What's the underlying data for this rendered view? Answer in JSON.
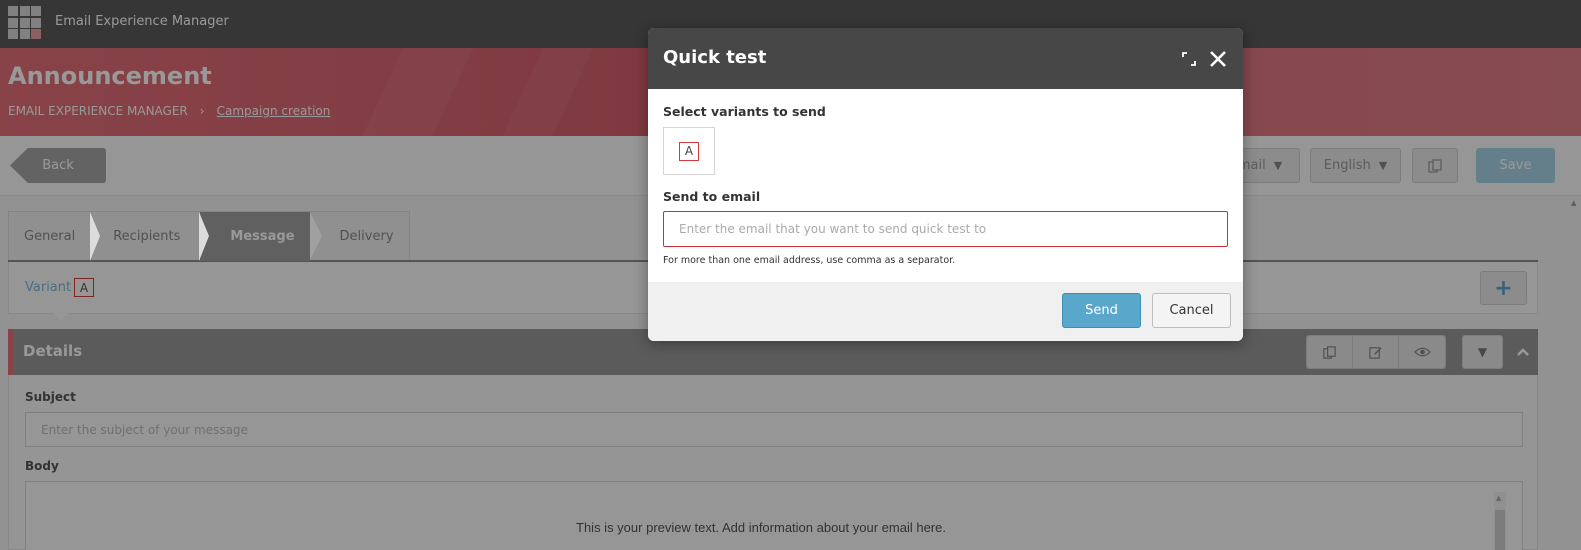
{
  "app": {
    "title": "Email Experience Manager"
  },
  "header": {
    "title": "Announcement",
    "breadcrumb": {
      "root": "EMAIL EXPERIENCE MANAGER",
      "current": "Campaign creation"
    }
  },
  "toolbar": {
    "back_label": "Back",
    "type_select_partial": "mail",
    "language_select": "English",
    "save_label": "Save"
  },
  "tabs": [
    {
      "label": "General"
    },
    {
      "label": "Recipients"
    },
    {
      "label": "Message",
      "active": true
    },
    {
      "label": "Delivery"
    }
  ],
  "variant_row": {
    "label": "Variant",
    "variant": "A"
  },
  "details": {
    "title": "Details",
    "subject_label": "Subject",
    "subject_placeholder": "Enter the subject of your message",
    "body_label": "Body",
    "body_preview": "This is your preview text. Add information about your email here."
  },
  "modal": {
    "title": "Quick test",
    "select_variants_label": "Select variants to send",
    "variant": "A",
    "send_to_label": "Send to email",
    "email_placeholder": "Enter the email that you want to send quick test to",
    "hint": "For more than one email address, use comma as a separator.",
    "send_label": "Send",
    "cancel_label": "Cancel"
  },
  "colors": {
    "brand_red": "#e3707a",
    "accent_blue": "#5aa7cc",
    "error_red": "#c8323a",
    "modal_header": "#474747"
  },
  "icons": {
    "app_launcher": "grid-icon",
    "copy": "copy-icon",
    "edit": "edit-icon",
    "preview": "eye-icon",
    "expand": "expand-icon",
    "close": "close-icon",
    "add": "plus-icon"
  }
}
